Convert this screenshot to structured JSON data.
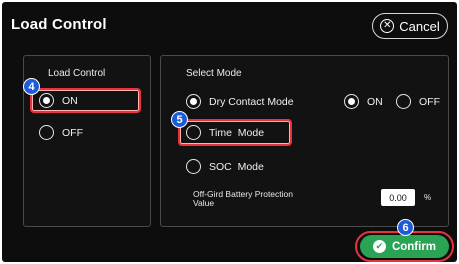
{
  "header": {
    "title": "Load Control",
    "cancel_label": "Cancel"
  },
  "left_panel": {
    "title": "Load Control",
    "options": [
      {
        "label": "ON",
        "selected": true
      },
      {
        "label": "OFF",
        "selected": false
      }
    ]
  },
  "right_panel": {
    "title": "Select Mode",
    "modes": [
      {
        "label": "Dry Contact Mode",
        "selected": true
      },
      {
        "label": "Time  Mode",
        "selected": false
      },
      {
        "label": "SOC  Mode",
        "selected": false
      }
    ],
    "dry_contact_toggle": [
      {
        "label": "ON",
        "selected": true
      },
      {
        "label": "OFF",
        "selected": false
      }
    ],
    "protection": {
      "label_line1": "Off-Gird Battery Protection",
      "label_line2": "Value",
      "value": "0.00",
      "unit": "%"
    }
  },
  "footer": {
    "confirm_label": "Confirm"
  },
  "badges": {
    "b4": "4",
    "b5": "5",
    "b6": "6"
  },
  "colors": {
    "background": "#0d0d0d",
    "highlight": "#e8323c",
    "badge": "#1e5bd8",
    "confirm": "#2aa354"
  }
}
